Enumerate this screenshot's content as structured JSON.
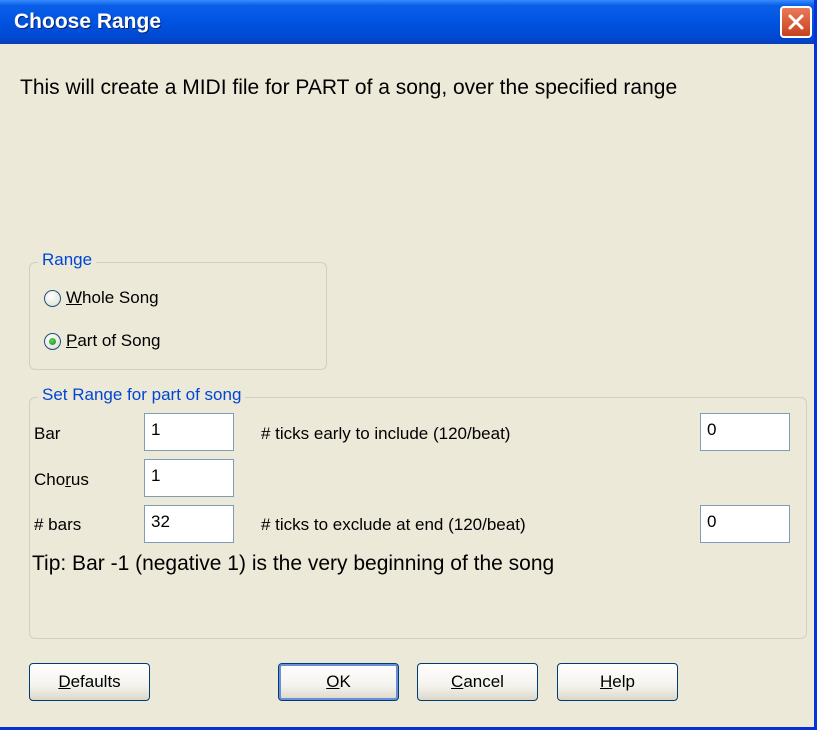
{
  "window": {
    "title": "Choose Range",
    "description": "This will create a MIDI file for PART of a song, over the specified range"
  },
  "range_group": {
    "legend": "Range",
    "options": [
      {
        "label_first": "W",
        "label_rest": "hole Song",
        "checked": false
      },
      {
        "label_first": "P",
        "label_rest": "art of Song",
        "checked": true
      }
    ]
  },
  "set_range_group": {
    "legend": "Set Range for part of song",
    "bar": {
      "label": "Bar",
      "value": "1"
    },
    "chorus": {
      "label_before": "Cho",
      "label_u": "r",
      "label_after": "us",
      "value": "1"
    },
    "num_bars": {
      "label": "# bars",
      "value": "32"
    },
    "ticks_early": {
      "label": "# ticks early to include (120/beat)",
      "value": "0"
    },
    "ticks_exclude": {
      "label": "# ticks to exclude at end (120/beat)",
      "value": "0"
    },
    "tip": "Tip: Bar -1 (negative 1) is the very beginning of the song"
  },
  "buttons": {
    "defaults": {
      "first": "D",
      "rest": "efaults"
    },
    "ok": {
      "first": "O",
      "rest": "K"
    },
    "cancel": {
      "first": "C",
      "rest": "ancel"
    },
    "help": {
      "first": "H",
      "rest": "elp"
    }
  },
  "colors": {
    "titlebar": "#0053e1",
    "face": "#ece9d8",
    "legend": "#0046d5",
    "close": "#c8401c"
  }
}
